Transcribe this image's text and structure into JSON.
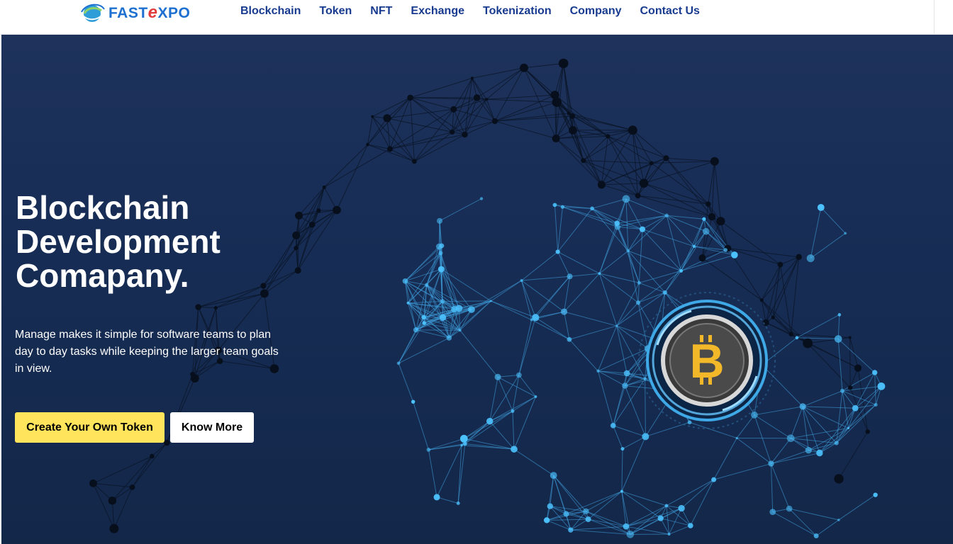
{
  "brand": {
    "logo_part1": "FAST",
    "logo_part2": "e",
    "logo_part3": "XPO",
    "primary_color": "#1d6fd0",
    "accent_color": "#e23b3b"
  },
  "nav": {
    "items": [
      {
        "label": "Blockchain"
      },
      {
        "label": "Token"
      },
      {
        "label": "NFT"
      },
      {
        "label": "Exchange",
        "active": true
      },
      {
        "label": "Tokenization"
      },
      {
        "label": "Company"
      },
      {
        "label": "Contact Us"
      }
    ]
  },
  "hero": {
    "headline_line1": "Blockchain",
    "headline_line2": "Development",
    "headline_line3": "Comapany.",
    "description": "Manage makes it simple for software teams to plan day to day tasks while keeping the larger team goals in view.",
    "primary_button": "Create Your Own Token",
    "secondary_button": "Know More",
    "background_color": "#172d55",
    "button_color": "#ffe45c",
    "graphic_icon": "bitcoin-coin-icon"
  }
}
